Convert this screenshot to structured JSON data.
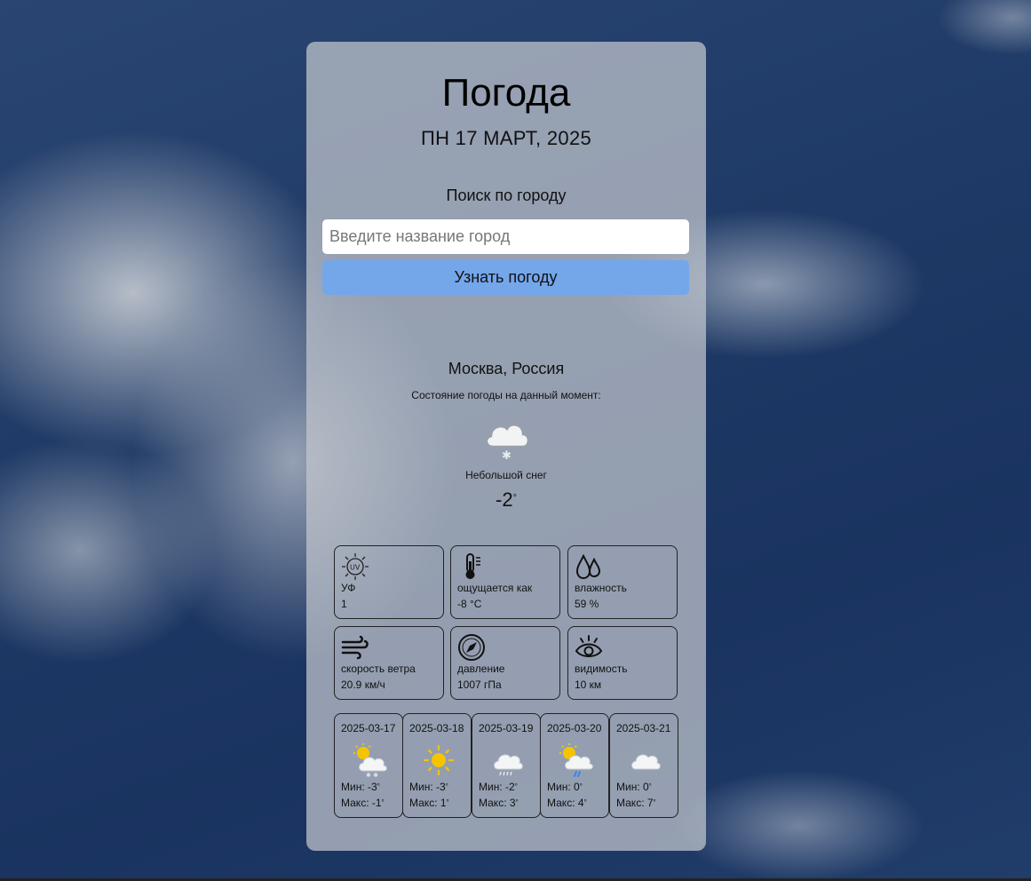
{
  "header": {
    "title": "Погода",
    "date": "ПН 17 МАРТ, 2025"
  },
  "search": {
    "label": "Поиск по городу",
    "placeholder": "Введите название город",
    "value": "",
    "button_label": "Узнать погоду"
  },
  "current": {
    "location": "Москва, Россия",
    "caption": "Состояние погоды на данный момент:",
    "icon": "cloud-snow-icon",
    "condition": "Небольшой снег",
    "temperature": "-2",
    "degree": "°"
  },
  "details": [
    {
      "icon": "uv-icon",
      "label": "УФ",
      "value": "1"
    },
    {
      "icon": "thermometer-icon",
      "label": "ощущается как",
      "value": "-8 °C"
    },
    {
      "icon": "humidity-icon",
      "label": "влажность",
      "value": "59 %"
    },
    {
      "icon": "wind-icon",
      "label": "скорость ветра",
      "value": "20.9 км/ч"
    },
    {
      "icon": "pressure-icon",
      "label": "давление",
      "value": "1007 гПа"
    },
    {
      "icon": "visibility-icon",
      "label": "видимость",
      "value": "10 км"
    }
  ],
  "forecast": [
    {
      "date": "2025-03-17",
      "icon": "sun-cloud-snow-icon",
      "min": "Мин: -3",
      "max": "Макс: -1"
    },
    {
      "date": "2025-03-18",
      "icon": "sun-icon",
      "min": "Мин: -3",
      "max": "Макс: 1"
    },
    {
      "date": "2025-03-19",
      "icon": "cloud-sleet-icon",
      "min": "Мин: -2",
      "max": "Макс: 3"
    },
    {
      "date": "2025-03-20",
      "icon": "sun-cloud-rain-icon",
      "min": "Мин: 0",
      "max": "Макс: 4"
    },
    {
      "date": "2025-03-21",
      "icon": "cloud-icon",
      "min": "Мин: 0",
      "max": "Макс: 7"
    }
  ],
  "degree_symbol": "°",
  "colors": {
    "button": "#74a6ea",
    "card": "#c4c8ce",
    "sun": "#f5c400",
    "rain": "#3b82f6"
  }
}
